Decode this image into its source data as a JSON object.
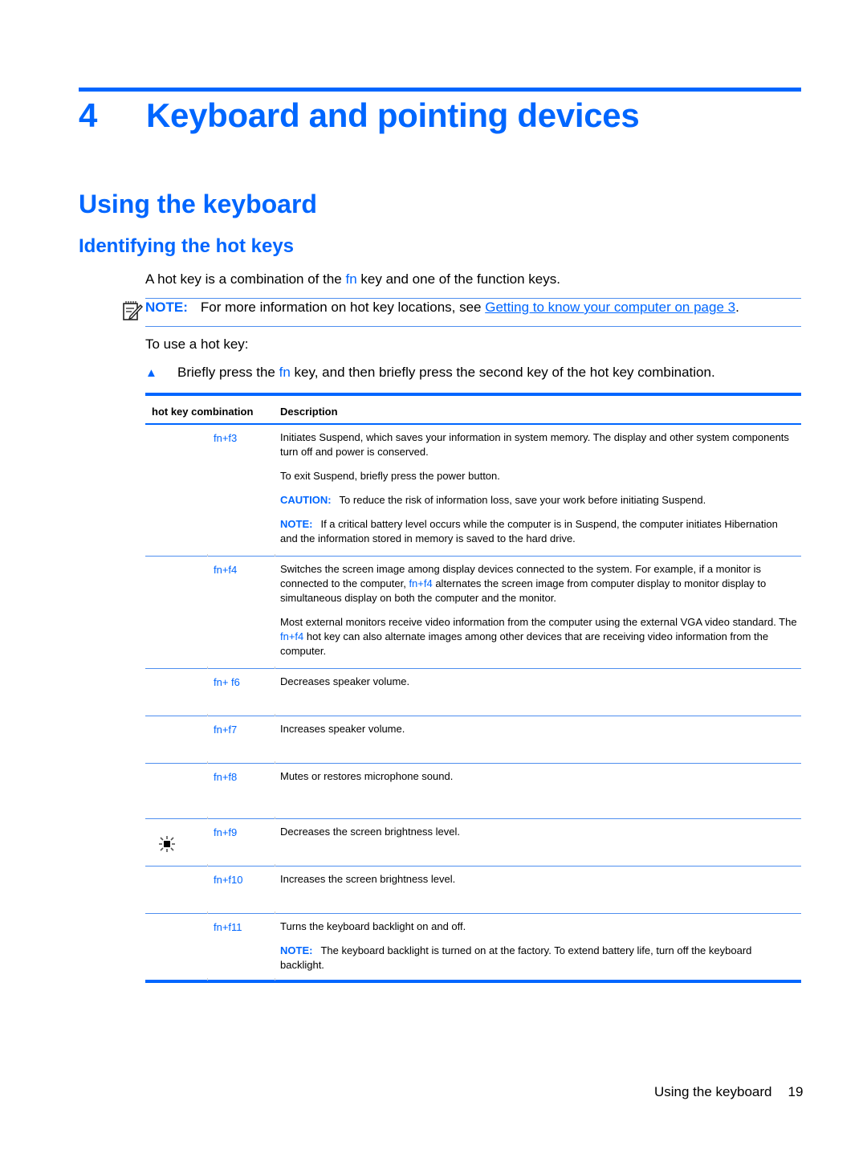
{
  "chapter": {
    "number": "4",
    "title": "Keyboard and pointing devices"
  },
  "section_title": "Using the keyboard",
  "subsection_title": "Identifying the hot keys",
  "intro": {
    "before": "A hot key is a combination of the ",
    "fn": "fn",
    "after": " key and one of the function keys."
  },
  "note": {
    "icon": "note-pencil-icon",
    "label": "NOTE:",
    "text": "For more information on hot key locations, see ",
    "link": "Getting to know your computer on page 3",
    "end": "."
  },
  "use_intro": "To use a hot key:",
  "step": {
    "bullet": "▲",
    "before": "Briefly press the ",
    "fn": "fn",
    "after": " key, and then briefly press the second key of the hot key combination."
  },
  "table": {
    "headers": [
      "hot key combination",
      "Description"
    ],
    "rows": [
      {
        "key": "fn+f3",
        "paragraphs": [
          {
            "text": "Initiates Suspend, which saves your information in system memory. The display and other system components turn off and power is conserved."
          },
          {
            "text": "To exit Suspend, briefly press the power button."
          },
          {
            "label": "CAUTION:",
            "text": "To reduce the risk of information loss, save your work before initiating Suspend."
          },
          {
            "label": "NOTE:",
            "text": "If a critical battery level occurs while the computer is in Suspend, the computer initiates Hibernation and the information stored in memory is saved to the hard drive."
          }
        ]
      },
      {
        "key": "fn+f4",
        "paragraphs": [
          {
            "text": "Switches the screen image among display devices connected to the system. For example, if a monitor is connected to the computer, ",
            "fnkey": "fn+f4",
            "text2": " alternates the screen image from computer display to monitor display to simultaneous display on both the computer and the monitor."
          },
          {
            "text": "Most external monitors receive video information from the computer using the external VGA video standard. The ",
            "fnkey": "fn+f4",
            "text2": " hot key can also alternate images among other devices that are receiving video information from the computer."
          }
        ]
      },
      {
        "key": "fn+ f6",
        "paragraphs": [
          {
            "text": "Decreases speaker volume."
          }
        ]
      },
      {
        "key": "fn+f7",
        "paragraphs": [
          {
            "text": "Increases speaker volume."
          }
        ]
      },
      {
        "key": "fn+f8",
        "paragraphs": [
          {
            "text": "Mutes or restores microphone sound."
          }
        ]
      },
      {
        "key": "fn+f9",
        "icon": "brightness-icon",
        "paragraphs": [
          {
            "text": "Decreases the screen brightness level."
          }
        ]
      },
      {
        "key": "fn+f10",
        "paragraphs": [
          {
            "text": "Increases the screen brightness level."
          }
        ]
      },
      {
        "key": "fn+f11",
        "paragraphs": [
          {
            "text": "Turns the keyboard backlight on and off."
          },
          {
            "label": "NOTE:",
            "text": "The keyboard backlight is turned on at the factory. To extend battery life, turn off the keyboard backlight."
          }
        ]
      }
    ]
  },
  "footer": {
    "section": "Using the keyboard",
    "page": "19"
  }
}
